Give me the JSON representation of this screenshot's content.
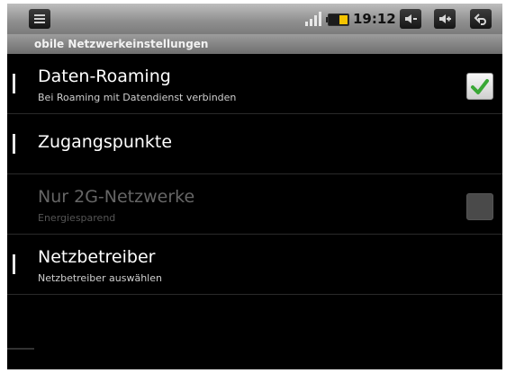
{
  "status_bar": {
    "time": "19:12",
    "icons": {
      "notifications": "notification-list-icon",
      "signal": "signal-strength-icon",
      "battery": "battery-icon",
      "volume_down": "volume-down-icon",
      "volume_up": "volume-up-icon",
      "back": "back-icon"
    },
    "battery_level": 0.45
  },
  "title_bar": {
    "title": "obile Netzwerkeinstellungen"
  },
  "settings": [
    {
      "title": "Daten-Roaming",
      "summary": "Bei Roaming mit Datendienst verbinden",
      "checkbox": "checked",
      "enabled": true
    },
    {
      "title": "Zugangspunkte",
      "summary": "",
      "checkbox": "none",
      "enabled": true
    },
    {
      "title": "Nur 2G-Netzwerke",
      "summary": "Energiesparend",
      "checkbox": "unchecked",
      "enabled": false
    },
    {
      "title": "Netzbetreiber",
      "summary": "Netzbetreiber auswählen",
      "checkbox": "none",
      "enabled": true
    }
  ],
  "colors": {
    "check_green": "#3aa836",
    "accent_yellow": "#f4c400"
  }
}
